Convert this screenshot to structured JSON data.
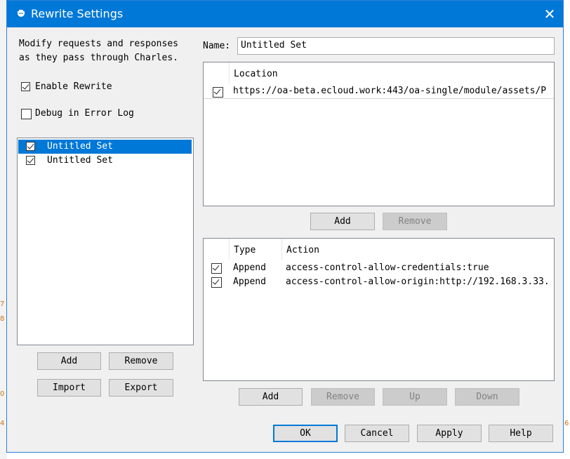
{
  "background_app": {
    "marks": [
      "7",
      "8",
      "0",
      "4",
      "6"
    ]
  },
  "window": {
    "title": "Rewrite Settings",
    "close_glyph": "✕"
  },
  "left": {
    "description": "Modify requests and responses\nas they pass through Charles.",
    "enable_rewrite": {
      "label": "Enable Rewrite",
      "checked": true
    },
    "debug_log": {
      "label": "Debug in Error Log",
      "checked": false
    },
    "sets": [
      {
        "label": "Untitled Set",
        "checked": true,
        "selected": true
      },
      {
        "label": "Untitled Set",
        "checked": true,
        "selected": false
      }
    ],
    "buttons": {
      "add": "Add",
      "remove": "Remove",
      "import": "Import",
      "export": "Export"
    }
  },
  "right": {
    "name_label": "Name:",
    "name_value": "Untitled Set",
    "locations": {
      "header": "Location",
      "rows": [
        {
          "checked": true,
          "value": "https://oa-beta.ecloud.work:443/oa-single/module/assets/P"
        }
      ]
    },
    "location_buttons": {
      "add": "Add",
      "remove": "Remove"
    },
    "rules": {
      "headers": {
        "type": "Type",
        "action": "Action"
      },
      "rows": [
        {
          "checked": true,
          "type": "Append",
          "action": "access-control-allow-credentials:true"
        },
        {
          "checked": true,
          "type": "Append",
          "action": "access-control-allow-origin:http://192.168.3.33."
        }
      ]
    },
    "rule_buttons": {
      "add": "Add",
      "remove": "Remove",
      "up": "Up",
      "down": "Down"
    }
  },
  "footer": {
    "ok": "OK",
    "cancel": "Cancel",
    "apply": "Apply",
    "help": "Help"
  }
}
